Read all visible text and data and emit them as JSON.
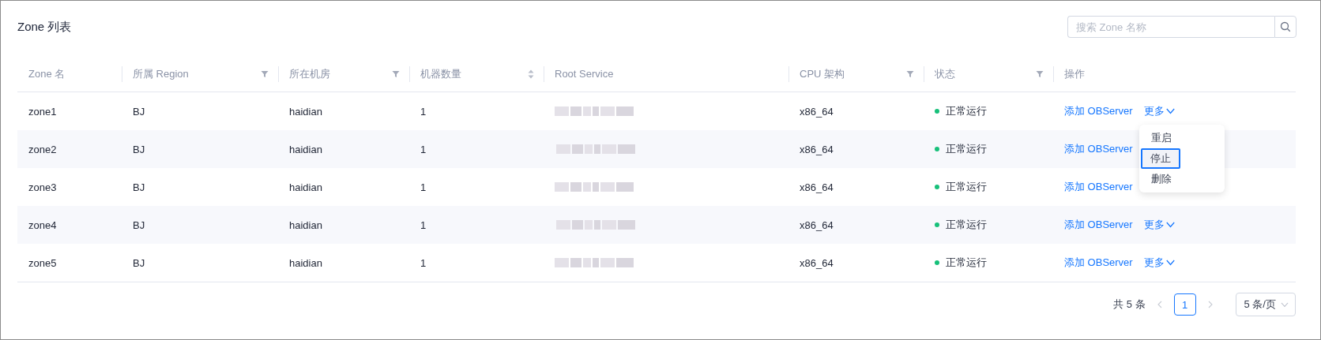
{
  "title": "Zone 列表",
  "search": {
    "placeholder": "搜索 Zone 名称"
  },
  "table": {
    "columns": [
      {
        "label": "Zone 名",
        "kind": "plain"
      },
      {
        "label": "所属 Region",
        "kind": "filter"
      },
      {
        "label": "所在机房",
        "kind": "filter"
      },
      {
        "label": "机器数量",
        "kind": "sort"
      },
      {
        "label": "Root Service",
        "kind": "plain"
      },
      {
        "label": "CPU 架构",
        "kind": "filter"
      },
      {
        "label": "状态",
        "kind": "filter"
      },
      {
        "label": "操作",
        "kind": "plain"
      }
    ],
    "rows": [
      {
        "zone": "zone1",
        "region": "BJ",
        "idc": "haidian",
        "count": "1",
        "root_service_blurred": true,
        "cpu": "x86_64",
        "status": "正常运行",
        "color": "#17c07a",
        "actions": [
          "添加 OBServer",
          "更多"
        ]
      },
      {
        "zone": "zone2",
        "region": "BJ",
        "idc": "haidian",
        "count": "1",
        "root_service_blurred": true,
        "cpu": "x86_64",
        "status": "正常运行",
        "color": "#17c07a",
        "actions": [
          "添加 OBServer"
        ]
      },
      {
        "zone": "zone3",
        "region": "BJ",
        "idc": "haidian",
        "count": "1",
        "root_service_blurred": true,
        "cpu": "x86_64",
        "status": "正常运行",
        "color": "#17c07a",
        "actions": [
          "添加 OBServer"
        ]
      },
      {
        "zone": "zone4",
        "region": "BJ",
        "idc": "haidian",
        "count": "1",
        "root_service_blurred": true,
        "cpu": "x86_64",
        "status": "正常运行",
        "color": "#17c07a",
        "actions": [
          "添加 OBServer",
          "更多"
        ]
      },
      {
        "zone": "zone5",
        "region": "BJ",
        "idc": "haidian",
        "count": "1",
        "root_service_blurred": true,
        "cpu": "x86_64",
        "status": "正常运行",
        "color": "#17c07a",
        "actions": [
          "添加 OBServer",
          "更多"
        ]
      }
    ]
  },
  "menu": {
    "items": [
      {
        "label": "重启",
        "selected": false
      },
      {
        "label": "停止",
        "selected": true
      },
      {
        "label": "删除",
        "selected": false
      }
    ]
  },
  "pagination": {
    "total": "共 5 条",
    "pages": [
      {
        "label": "1",
        "selected": true
      }
    ],
    "page_size": "5 条/页"
  }
}
